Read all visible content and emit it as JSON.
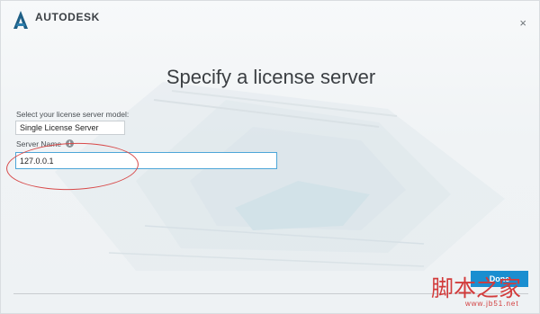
{
  "header": {
    "brand": "AUTODESK",
    "close_glyph": "×"
  },
  "title": "Specify a license server",
  "form": {
    "model_label": "Select your license server model:",
    "model_value": "Single License Server",
    "server_name_label": "Server Name",
    "info_glyph": "i",
    "server_name_value": "127.0.0.1"
  },
  "footer": {
    "done_label": "Done"
  },
  "watermark": {
    "text_cn": "脚本之家",
    "url": "www.jb51.net"
  },
  "colors": {
    "accent": "#1a8ed0",
    "annotation": "#d84a4a"
  },
  "icons": {
    "logo": "autodesk-a-icon",
    "close": "close-icon",
    "info": "info-icon"
  }
}
